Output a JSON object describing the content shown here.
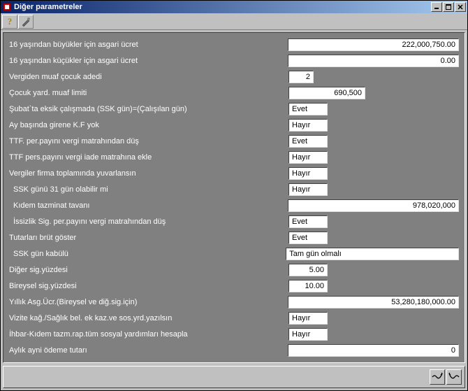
{
  "window": {
    "title": "Diğer parametreler"
  },
  "rows": [
    {
      "label": "16 yaşından büyükler için asgari ücret",
      "value": "222,000,750.00",
      "cls": "num w-lg",
      "indent": false
    },
    {
      "label": "16 yaşından küçükler için asgari ücret",
      "value": "0.00",
      "cls": "num w-lg",
      "indent": false
    },
    {
      "label": "Vergiden muaf çocuk adedi",
      "value": "2",
      "cls": "num w-sm",
      "indent": false
    },
    {
      "label": "Çocuk yard. muaf limiti",
      "value": "690,500",
      "cls": "num w-md",
      "indent": false
    },
    {
      "label": "Şubat`ta eksik çalışmada (SSK gün)=(Çalışılan gün)",
      "value": "Evet",
      "cls": "w-drop",
      "indent": false
    },
    {
      "label": "Ay başında girene K.F yok",
      "value": "Hayır",
      "cls": "w-drop",
      "indent": false
    },
    {
      "label": "TTF. per.payını vergi matrahından düş",
      "value": "Evet",
      "cls": "w-drop",
      "indent": false
    },
    {
      "label": "TTF pers.payını vergi iade matrahına ekle",
      "value": "Hayır",
      "cls": "w-drop",
      "indent": false
    },
    {
      "label": "Vergiler firma toplamında yuvarlansın",
      "value": "Hayır",
      "cls": "w-drop",
      "indent": false
    },
    {
      "label": "SSK günü 31 gün olabilir mi",
      "value": "Hayır",
      "cls": "w-drop",
      "indent": true
    },
    {
      "label": "Kıdem tazminat tavanı",
      "value": "978,020,000",
      "cls": "num w-num2",
      "indent": true
    },
    {
      "label": "İssizlik Sig. per.payını vergi matrahından düş",
      "value": "Evet",
      "cls": "w-drop",
      "indent": true
    },
    {
      "label": "Tutarları brüt göster",
      "value": "Evet",
      "cls": "w-drop",
      "indent": false
    },
    {
      "label": "SSK gün kabülü",
      "value": "Tam gün olmalı",
      "cls": "w-drop2",
      "indent": true
    },
    {
      "label": "Diğer sig.yüzdesi",
      "value": "5.00",
      "cls": "num w-xs",
      "indent": false
    },
    {
      "label": "Bireysel sig.yüzdesi",
      "value": "10.00",
      "cls": "num w-xs",
      "indent": false
    },
    {
      "label": "Yıllık Asg.Ücr.(Bireysel ve diğ.sig.için)",
      "value": "53,280,180,000.00",
      "cls": "num w-num2",
      "indent": false
    },
    {
      "label": "Vizite kağ./Sağlık bel. ek kaz.ve sos.yrd.yazılsın",
      "value": "Hayır",
      "cls": "w-drop",
      "indent": false
    },
    {
      "label": "İhbar-Kıdem tazm.rap.tüm sosyal yardımları hesapla",
      "value": "Hayır",
      "cls": "w-drop",
      "indent": false
    },
    {
      "label": "Aylık ayni ödeme tutarı",
      "value": "0",
      "cls": "num w-num2",
      "indent": false
    }
  ]
}
